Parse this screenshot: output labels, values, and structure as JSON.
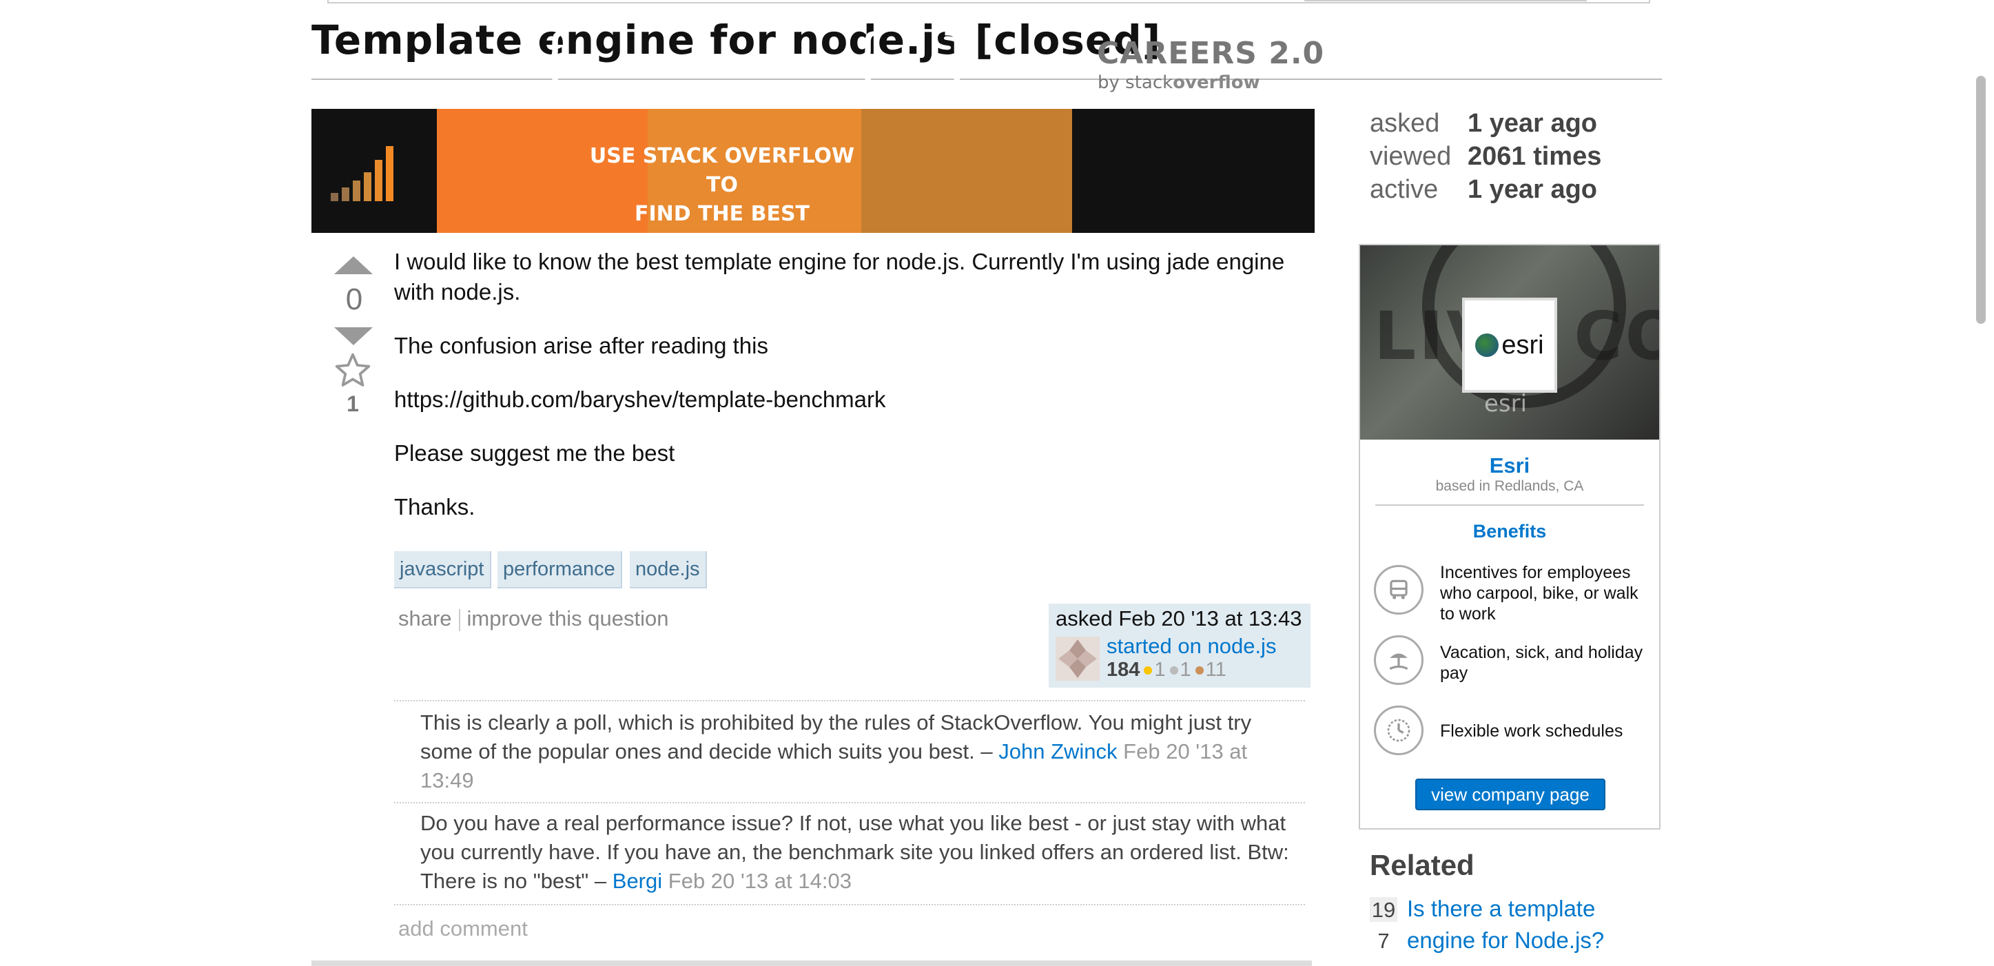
{
  "question": {
    "title": "Template engine for node.js [closed]",
    "votes": "0",
    "favorites": "1",
    "body": [
      "I would like to know the best template engine for node.js. Currently I'm using jade engine with node.js.",
      "The confusion arise after reading this",
      "https://github.com/baryshev/template-benchmark",
      "Please suggest me the best",
      "Thanks."
    ],
    "tags": [
      "javascript",
      "performance",
      "node.js"
    ],
    "menu": {
      "share": "share",
      "improve": "improve this question"
    },
    "owner": {
      "asked": "asked Feb 20 '13 at 13:43",
      "name": "started on node.js",
      "reputation": "184",
      "gold": "1",
      "silver": "1",
      "bronze": "11"
    }
  },
  "comments": [
    {
      "text": "This is clearly a poll, which is prohibited by the rules of StackOverflow. You might just try some of the popular ones and decide which suits you best. – ",
      "user": "John Zwinck",
      "date": "Feb 20 '13 at 13:49"
    },
    {
      "text": "Do you have a real performance issue? If not, use what you like best - or just stay with what you currently have. If you have an, the benchmark site you linked offers an ordered list. Btw: There is no \"best\" – ",
      "user": "Bergi",
      "date": "Feb 20 '13 at 14:03"
    }
  ],
  "add_comment": "add comment",
  "banner": {
    "line1": "USE STACK OVERFLOW TO",
    "line2": "FIND THE BEST DEVELOPERS",
    "careers": "CAREERS 2.0",
    "careers_by": "by stack",
    "careers_brand": "overflow"
  },
  "stats": [
    {
      "label": "asked",
      "value": "1 year ago"
    },
    {
      "label": "viewed",
      "value": "2061 times"
    },
    {
      "label": "active",
      "value": "1 year ago"
    }
  ],
  "company": {
    "logo_text": "esri",
    "image_big_text": "LIVE CODE",
    "image_small_text": "esri",
    "name": "Esri",
    "location": "based in Redlands, CA",
    "benefits_title": "Benefits",
    "benefits": [
      {
        "icon": "bus-icon",
        "text": "Incentives for employees who carpool, bike, or walk to work"
      },
      {
        "icon": "beach-icon",
        "text": "Vacation, sick, and holiday pay"
      },
      {
        "icon": "clock-icon",
        "text": "Flexible work schedules"
      }
    ],
    "button": "view company page"
  },
  "related": {
    "title": "Related",
    "items": [
      {
        "count_top": "19",
        "count_bottom": "7",
        "title": "Is there a template engine for Node.js?"
      }
    ]
  },
  "colors": {
    "link": "#0077cc",
    "tag_bg": "#e0eaf1",
    "banner_orange": "#f47a2a"
  }
}
